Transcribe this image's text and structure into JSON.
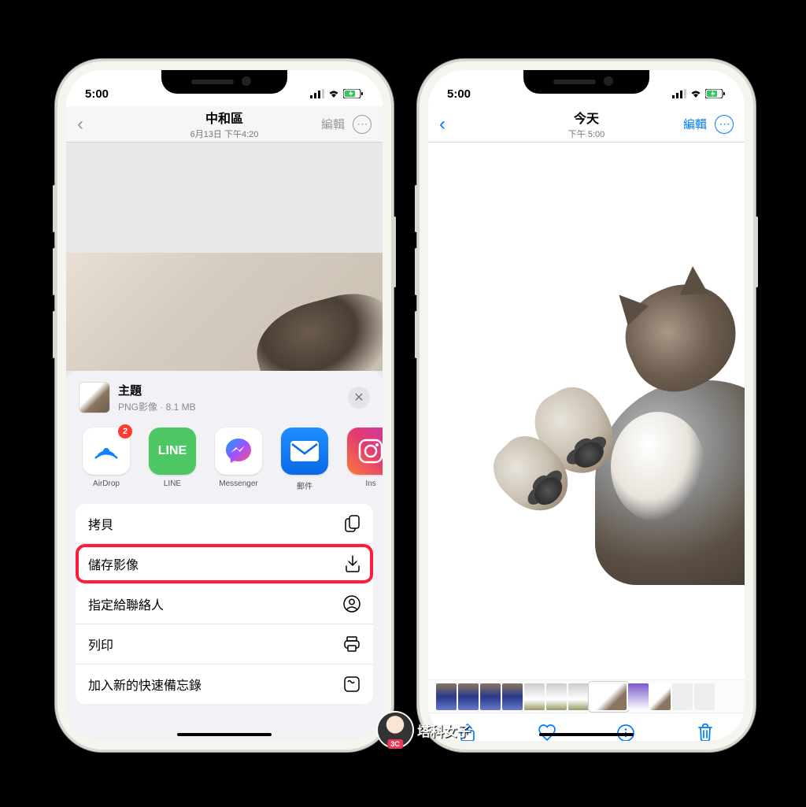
{
  "status": {
    "time": "5:00"
  },
  "left": {
    "nav": {
      "title": "中和區",
      "subtitle": "6月13日 下午4:20",
      "edit": "編輯"
    },
    "sheet": {
      "title": "主題",
      "subtitle": "PNG影像 · 8.1 MB",
      "apps": [
        {
          "label": "AirDrop",
          "badge": "2"
        },
        {
          "label": "LINE"
        },
        {
          "label": "Messenger"
        },
        {
          "label": "郵件"
        },
        {
          "label": "Ins"
        }
      ],
      "actions": [
        {
          "label": "拷貝",
          "icon": "copy"
        },
        {
          "label": "儲存影像",
          "icon": "save",
          "highlight": true
        },
        {
          "label": "指定給聯絡人",
          "icon": "contact"
        },
        {
          "label": "列印",
          "icon": "print"
        },
        {
          "label": "加入新的快速備忘錄",
          "icon": "note"
        }
      ]
    }
  },
  "right": {
    "nav": {
      "title": "今天",
      "subtitle": "下午 5:00",
      "edit": "編輯"
    }
  },
  "watermark": "塔科女子"
}
